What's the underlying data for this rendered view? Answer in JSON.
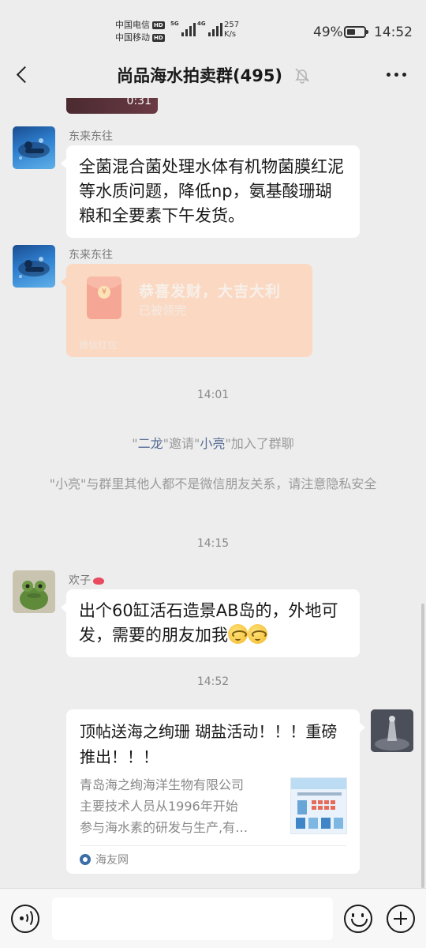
{
  "status_bar": {
    "carrier_1": "中国电信",
    "carrier_2": "中国移动",
    "hd": "HD",
    "net_1": "5G",
    "net_2": "4G",
    "speed_value": "257",
    "speed_unit": "K/s",
    "battery_percent": "49%",
    "battery_level": 0.49,
    "time": "14:52"
  },
  "nav": {
    "title": "尚品海水拍卖群(495)",
    "muted_icon": "bell-off-icon",
    "more_icon": "more-dots-icon"
  },
  "chat": {
    "video_stub_duration": "0:31",
    "messages": [
      {
        "sender": "东来东往",
        "text": "全菌混合菌处理水体有机物菌膜红泥等水质问题，降低np，氨基酸珊瑚粮和全要素下午发货。"
      },
      {
        "sender": "东来东往",
        "red_packet": {
          "title": "恭喜发财，大吉大利",
          "status": "已被领完",
          "label": "微信红包",
          "coin_glyph": "¥"
        }
      }
    ],
    "time_1": "14:01",
    "system_invite": {
      "quote_open": "\"",
      "inviter": "二龙",
      "middle": "\"邀请\"",
      "invitee": "小亮",
      "suffix": "\"加入了群聊"
    },
    "system_notice": "\"小亮\"与群里其他人都不是微信朋友关系，请注意隐私安全",
    "time_2": "14:15",
    "message_3": {
      "sender": "欢子",
      "text": "出个60缸活石造景AB岛的，外地可发，需要的朋友加我"
    },
    "time_3": "14:52",
    "share_card": {
      "title": "顶帖送海之绚珊 瑚盐活动！！！重磅推出！！！",
      "desc_lines": [
        "青岛海之绚海洋生物有限公司",
        "主要技术人员从1996年开始",
        "参与海水素的研发与生产,有…"
      ],
      "source": "海友网"
    }
  },
  "input_bar": {
    "voice_icon": "voice-icon",
    "emoji_icon": "emoji-icon",
    "plus_icon": "plus-icon",
    "input_value": ""
  }
}
